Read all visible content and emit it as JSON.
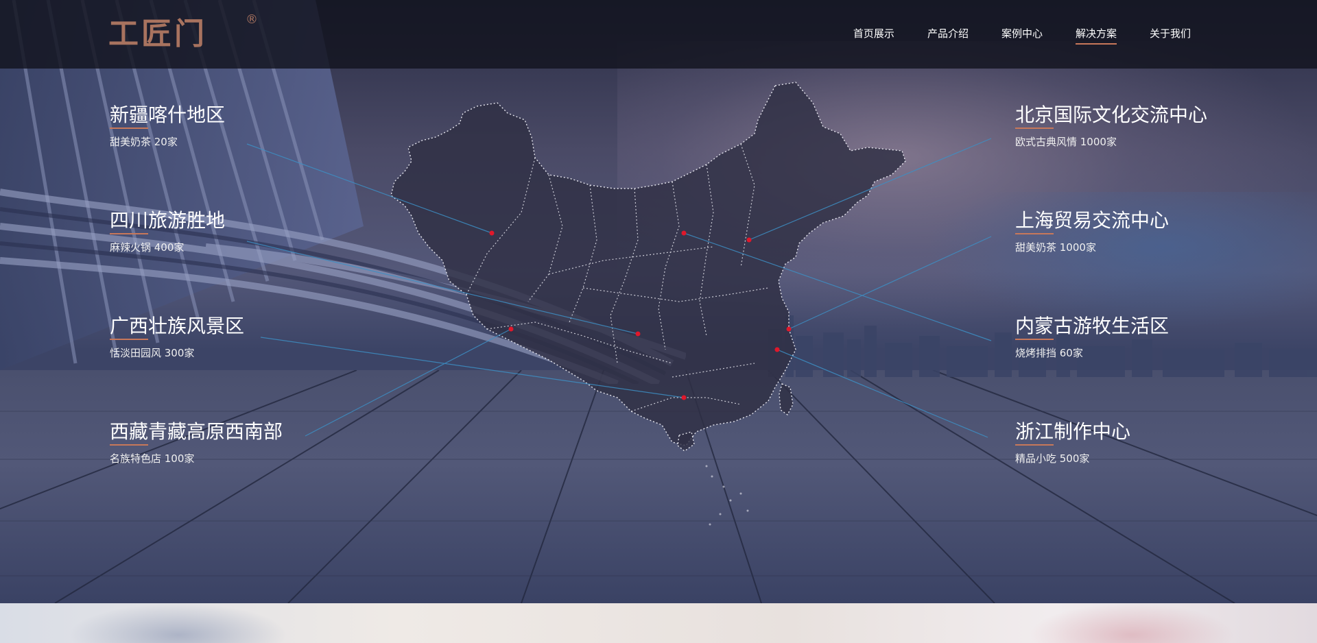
{
  "header": {
    "logo_text": "工匠门",
    "logo_mark": "®",
    "nav": [
      {
        "label": "首页展示",
        "active": false
      },
      {
        "label": "产品介绍",
        "active": false
      },
      {
        "label": "案例中心",
        "active": false
      },
      {
        "label": "解决方案",
        "active": true
      },
      {
        "label": "关于我们",
        "active": false
      }
    ]
  },
  "locations_left": [
    {
      "title": "新疆喀什地区",
      "subtitle": "甜美奶茶 20家"
    },
    {
      "title": "四川旅游胜地",
      "subtitle": "麻辣火锅 400家"
    },
    {
      "title": "广西壮族风景区",
      "subtitle": "恬淡田园风 300家"
    },
    {
      "title": "西藏青藏高原西南部",
      "subtitle": "名族特色店 100家"
    }
  ],
  "locations_right": [
    {
      "title": "北京国际文化交流中心",
      "subtitle": "欧式古典风情 1000家"
    },
    {
      "title": "上海贸易交流中心",
      "subtitle": "甜美奶茶 1000家"
    },
    {
      "title": "内蒙古游牧生活区",
      "subtitle": "烧烤排挡 60家"
    },
    {
      "title": "浙江制作中心",
      "subtitle": "精品小吃 500家"
    }
  ],
  "colors": {
    "accent": "#c8785a",
    "logo": "#a8735f",
    "marker": "#e0182b",
    "connector": "#3d8fc4",
    "header_bg": "#12141e"
  },
  "icons": {
    "map": "china-map-icon",
    "marker": "location-dot-icon"
  }
}
